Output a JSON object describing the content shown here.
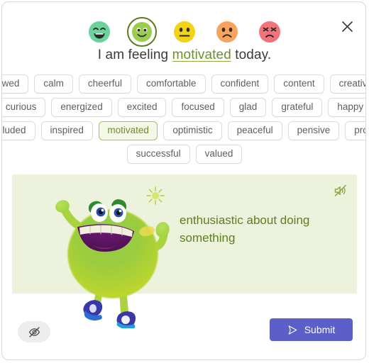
{
  "window": {
    "close_label": "Close",
    "close_icon": "close-icon"
  },
  "mood_scale": {
    "icon_name": "emoji-face",
    "options": [
      {
        "name": "very-happy",
        "label": "Very happy",
        "face": "grin",
        "color": "#6ad29a",
        "selected": false
      },
      {
        "name": "happy",
        "label": "Happy",
        "face": "smile",
        "color": "#9acd4e",
        "selected": true
      },
      {
        "name": "neutral",
        "label": "Neutral",
        "face": "neutral",
        "color": "#f2d417",
        "selected": false
      },
      {
        "name": "sad",
        "label": "Sad",
        "face": "frown",
        "color": "#f7a35c",
        "selected": false
      },
      {
        "name": "very-sad",
        "label": "Very sad",
        "face": "distress",
        "color": "#f2737a",
        "selected": false
      }
    ]
  },
  "prompt": {
    "before": "I am feeling ",
    "word": "motivated",
    "after": " today."
  },
  "tag_cloud": {
    "selected": "motivated",
    "rows": [
      [
        "awed",
        "calm",
        "cheerful",
        "comfortable",
        "confident",
        "content",
        "creative"
      ],
      [
        "curious",
        "energized",
        "excited",
        "focused",
        "glad",
        "grateful",
        "happy"
      ],
      [
        "included",
        "inspired",
        "motivated",
        "optimistic",
        "peaceful",
        "pensive",
        "proud"
      ],
      [
        "successful",
        "valued"
      ]
    ]
  },
  "definition_card": {
    "text": "enthusiastic about doing something",
    "background": "#edf2dc",
    "text_color": "#5f7d21",
    "mute_icon": "speaker-mute-icon",
    "mute_label": "Mute audio",
    "character_alt": "green furry monster character cheering"
  },
  "footer": {
    "hide_icon": "eye-off-icon",
    "hide_label": "Hide",
    "submit_label": "Submit",
    "submit_icon": "send-icon",
    "submit_color": "#5b5fc7"
  }
}
